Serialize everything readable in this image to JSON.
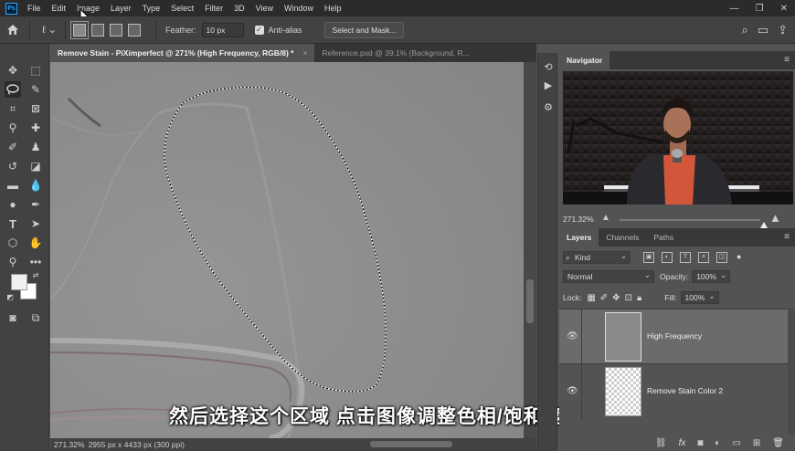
{
  "menu": {
    "items": [
      "File",
      "Edit",
      "Image",
      "Layer",
      "Type",
      "Select",
      "Filter",
      "3D",
      "View",
      "Window",
      "Help"
    ],
    "logo": "Ps"
  },
  "options": {
    "feather_label": "Feather:",
    "feather_value": "10 px",
    "antialias_label": "Anti-alias",
    "antialias_checked": true,
    "select_mask_label": "Select and Mask..."
  },
  "tabs": [
    {
      "label": "Remove Stain - PiXimperfect @ 271% (High Frequency, RGB/8) *",
      "close": "×"
    },
    {
      "label": "Reference.psd @ 39.1% (Background, R...",
      "close": "×"
    }
  ],
  "status": {
    "zoom": "271.32%",
    "doc_info": "2955 px x 4433 px (300 ppi)"
  },
  "subtitle": "然后选择这个区域 点击图像调整色相/饱和度",
  "navigator": {
    "tab": "Navigator",
    "zoom": "271.32%"
  },
  "layers": {
    "tabs": [
      "Layers",
      "Channels",
      "Paths"
    ],
    "filter_kind": "Kind",
    "blend_mode": "Normal",
    "opacity_label": "Opacity:",
    "opacity_value": "100%",
    "lock_label": "Lock:",
    "fill_label": "Fill:",
    "fill_value": "100%",
    "items": [
      {
        "name": "High Frequency",
        "selected": true
      },
      {
        "name": "Remove Stain Color 2",
        "selected": false
      }
    ],
    "footer_fx": "fx"
  }
}
